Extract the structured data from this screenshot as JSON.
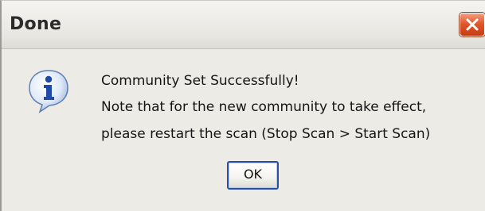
{
  "dialog": {
    "title": "Done",
    "icon": "info-icon",
    "close_icon": "close-icon",
    "message_lines": [
      "Community Set Successfully!",
      "Note that for the new community to take effect,",
      "please restart the scan (Stop Scan > Start Scan)"
    ],
    "ok_label": "OK"
  },
  "colors": {
    "close_button": "#e2582c",
    "ok_border": "#2a4ea8",
    "window_bg": "#ecebe6"
  }
}
